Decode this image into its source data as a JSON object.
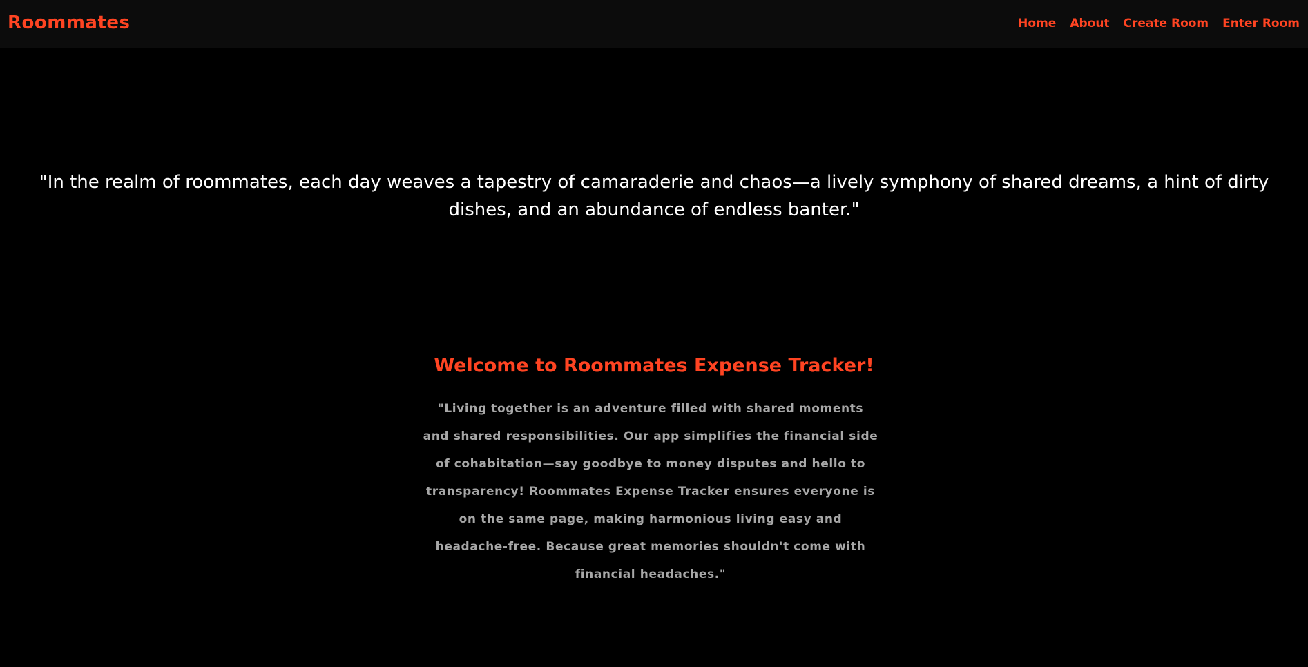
{
  "navbar": {
    "brand": "Roommates",
    "links": [
      {
        "label": "Home"
      },
      {
        "label": "About"
      },
      {
        "label": "Create Room"
      },
      {
        "label": "Enter Room"
      }
    ]
  },
  "hero": {
    "quote": "\"In the realm of roommates, each day weaves a tapestry of camaraderie and chaos—a lively symphony of shared dreams, a hint of dirty dishes, and an abundance of endless banter.\""
  },
  "welcome": {
    "heading": "Welcome to Roommates Expense Tracker!",
    "description": "\"Living together is an adventure filled with shared moments and shared responsibilities. Our app simplifies the financial side of cohabitation—say goodbye to money disputes and hello to transparency! Roommates Expense Tracker ensures everyone is on the same page, making harmonious living easy and headache-free. Because great memories shouldn't come with financial headaches.\""
  },
  "colors": {
    "accent": "#ff4422",
    "background": "#000000",
    "navbar_background": "#0c0c0c",
    "quote_text": "#ffffff",
    "description_text": "#a7a7a7"
  }
}
